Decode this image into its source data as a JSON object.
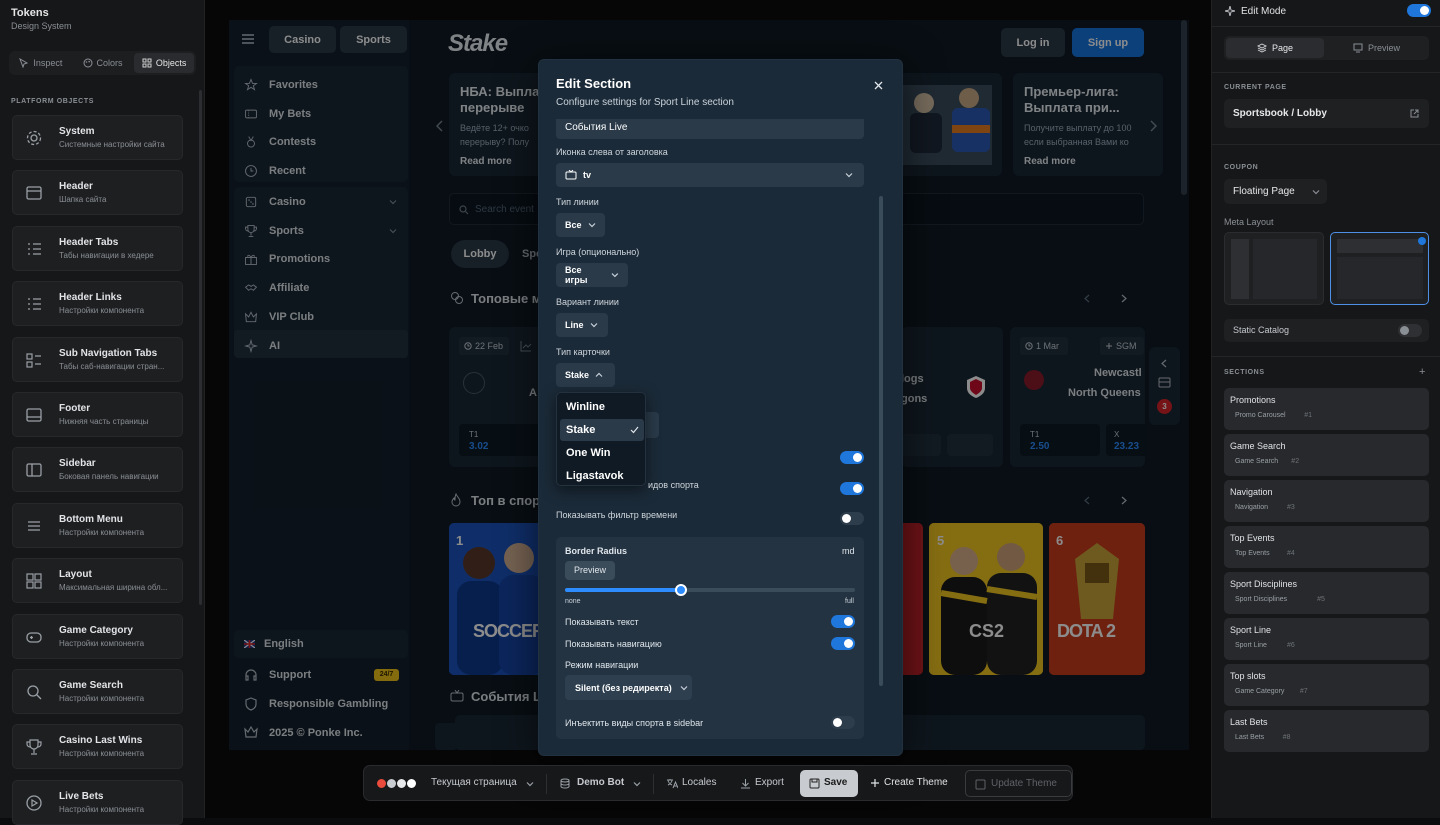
{
  "left_panel": {
    "brand": "Tokens",
    "brand_sub": "Design System",
    "tabs": [
      {
        "label": "Inspect",
        "icon": "inspect-icon"
      },
      {
        "label": "Colors",
        "icon": "palette-icon"
      },
      {
        "label": "Objects",
        "icon": "grid-icon"
      }
    ],
    "section_title": "PLATFORM OBJECTS",
    "objects": [
      {
        "name": "System",
        "desc": "Системные настройки сайта",
        "icon": "gear-icon"
      },
      {
        "name": "Header",
        "desc": "Шапка сайта",
        "icon": "window-icon"
      },
      {
        "name": "Header Tabs",
        "desc": "Табы навигации в хедере",
        "icon": "list-icon"
      },
      {
        "name": "Header Links",
        "desc": "Настройки компонента",
        "icon": "list-icon"
      },
      {
        "name": "Sub Navigation Tabs",
        "desc": "Табы саб-навигации стран...",
        "icon": "sublist-icon"
      },
      {
        "name": "Footer",
        "desc": "Нижняя часть страницы",
        "icon": "footer-icon"
      },
      {
        "name": "Sidebar",
        "desc": "Боковая панель навигации",
        "icon": "sidebar-icon"
      },
      {
        "name": "Bottom Menu",
        "desc": "Настройки компонента",
        "icon": "menu-icon"
      },
      {
        "name": "Layout",
        "desc": "Максимальная ширина обл...",
        "icon": "grid-icon"
      },
      {
        "name": "Game Category",
        "desc": "Настройки компонента",
        "icon": "gamepad-icon"
      },
      {
        "name": "Game Search",
        "desc": "Настройки компонента",
        "icon": "search-icon"
      },
      {
        "name": "Casino Last Wins",
        "desc": "Настройки компонента",
        "icon": "trophy-icon"
      },
      {
        "name": "Live Bets",
        "desc": "Настройки компонента",
        "icon": "play-icon"
      }
    ]
  },
  "site": {
    "header_tabs": [
      "Casino",
      "Sports"
    ],
    "logo": "Stake",
    "login": "Log in",
    "signup": "Sign up",
    "nav_top": [
      {
        "label": "Favorites",
        "icon": "star-icon"
      },
      {
        "label": "My Bets",
        "icon": "ticket-icon"
      },
      {
        "label": "Contests",
        "icon": "medal-icon"
      },
      {
        "label": "Recent",
        "icon": "clock-icon"
      }
    ],
    "nav_mid": [
      {
        "label": "Casino",
        "icon": "dice-icon",
        "chevron": true
      },
      {
        "label": "Sports",
        "icon": "trophy-icon",
        "chevron": true
      },
      {
        "label": "Promotions",
        "icon": "gift-icon",
        "chevron": false
      },
      {
        "label": "Affiliate",
        "icon": "handshake-icon",
        "chevron": false
      },
      {
        "label": "VIP Club",
        "icon": "crown-icon",
        "chevron": false
      },
      {
        "label": "AI",
        "icon": "sparkle-icon",
        "chevron": false
      }
    ],
    "language": "English",
    "support": "Support",
    "support_badge": "24/7",
    "responsible": "Responsible Gambling",
    "copyright": "2025 © Ponke Inc.",
    "promo1_title_1": "НБА: Выпла",
    "promo1_title_2": "перерыве",
    "promo1_text_1": "Ведёте 12+ очко",
    "promo1_text_2": "перерыву? Полу",
    "promo1_read": "Read more",
    "promo2_title_1": "Премьер-лига:",
    "promo2_title_2": "Выплата при...",
    "promo2_text_1": "Получите выплату до 100",
    "promo2_text_2": "если выбранная Вами ко",
    "promo2_read": "Read more",
    "search_placeholder": "Search event",
    "subtabs": [
      "Lobby",
      "Spo"
    ],
    "top_section": "Топовые м",
    "card1_date": "22 Feb",
    "card1_team": "A",
    "card1_odds_label": "T1",
    "card1_odds": "3.02",
    "card2_team_1": "logs",
    "card2_team_2": "gons",
    "card3_date": "1 Mar",
    "card3_sgm": "SGM",
    "card3_team_1": "Newcastl",
    "card3_team_2": "North Queens",
    "card3_o1_label": "T1",
    "card3_o1": "2.50",
    "card3_o2_label": "X",
    "card3_o2": "23.23",
    "sports_section": "Топ в спор",
    "tile_nums": [
      "1",
      "5",
      "6"
    ],
    "tile_texts": [
      "SOCCER",
      "CS2",
      "DOTA 2"
    ],
    "live_section": "События L",
    "side_badge": "3"
  },
  "modal": {
    "title": "Edit Section",
    "subtitle": "Configure settings for Sport Line section",
    "title_value": "События Live",
    "icon_label": "Иконка слева от заголовка",
    "icon_value": "tv",
    "line_type_label": "Тип линии",
    "line_type_value": "Все",
    "game_label": "Игра (опционально)",
    "game_value": "Все игры",
    "variant_label": "Вариант линии",
    "variant_value": "Line",
    "card_type_label": "Тип карточки",
    "card_type_value": "Stake",
    "dropdown_options": [
      "Winline",
      "Stake",
      "One Win",
      "Ligastavok"
    ],
    "selected_option": "Stake",
    "sports_partial": "идов спорта",
    "time_filter_label": "Показывать фильтр времени",
    "border_radius_label": "Border Radius",
    "border_radius_value": "md",
    "preview_label": "Preview",
    "slider_min": "none",
    "slider_max": "full",
    "slider_level": 0.4,
    "show_text_label": "Показывать текст",
    "show_nav_label": "Показывать навигацию",
    "nav_mode_label": "Режим навигации",
    "nav_mode_value": "Silent (без редиректа)",
    "inject_label": "Инъектить виды спорта в sidebar"
  },
  "bottom_bar": {
    "page_label": "Текущая страница",
    "bot_label": "Demo Bot",
    "locales": "Locales",
    "export": "Export",
    "save": "Save",
    "create_theme": "Create Theme",
    "update_theme": "Update Theme",
    "colors": [
      "#e94b3c",
      "#c9cdd2",
      "#e6e8ea",
      "#ffffff"
    ]
  },
  "right_panel": {
    "edit_mode": "Edit Mode",
    "page_tab": "Page",
    "preview_tab": "Preview",
    "current_page_label": "CURRENT PAGE",
    "current_page_value": "Sportsbook / Lobby",
    "coupon_label": "COUPON",
    "coupon_value": "Floating Page",
    "meta_layout_label": "Meta Layout",
    "static_catalog": "Static Catalog",
    "sections_label": "SECTIONS",
    "add_symbol": "+",
    "sections": [
      {
        "title": "Promotions",
        "tag": "Promo Carousel",
        "num": "#1"
      },
      {
        "title": "Game Search",
        "tag": "Game Search",
        "num": "#2"
      },
      {
        "title": "Navigation",
        "tag": "Navigation",
        "num": "#3"
      },
      {
        "title": "Top Events",
        "tag": "Top Events",
        "num": "#4"
      },
      {
        "title": "Sport Disciplines",
        "tag": "Sport Disciplines",
        "num": "#5"
      },
      {
        "title": "Sport Line",
        "tag": "Sport Line",
        "num": "#6"
      },
      {
        "title": "Top slots",
        "tag": "Game Category",
        "num": "#7"
      },
      {
        "title": "Last Bets",
        "tag": "Last Bets",
        "num": "#8"
      }
    ],
    "accent": "#1f76db"
  }
}
